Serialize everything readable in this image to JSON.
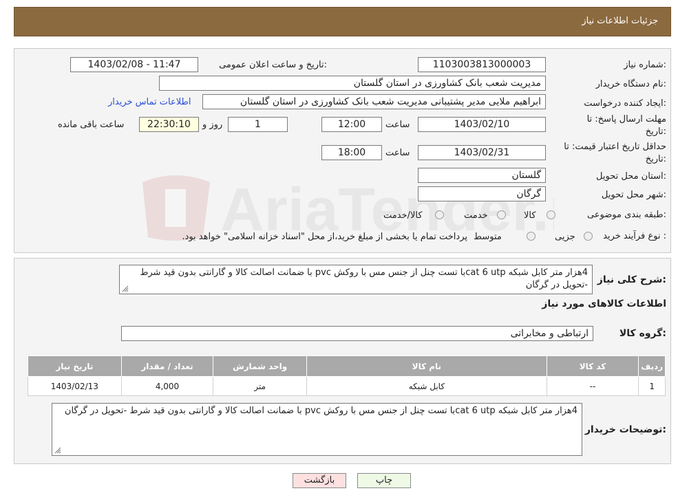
{
  "header": {
    "title": "جزئیات اطلاعات نیاز"
  },
  "form": {
    "need_number_label": "شماره نیاز:",
    "need_number": "1103003813000003",
    "announce_label": "تاریخ و ساعت اعلان عمومی:",
    "announce_value": "1403/02/08 - 11:47",
    "buyer_label": "نام دستگاه خریدار:",
    "buyer_value": "مدیریت شعب بانک کشاورزی در استان گلستان",
    "creator_label": "ایجاد کننده درخواست:",
    "creator_value": "ابراهیم ملایی  مدیر پشتیبانی مدیریت شعب بانک کشاورزی در استان گلستان",
    "contact_link": "اطلاعات تماس خریدار",
    "deadline_label_1": "مهلت ارسال پاسخ: تا",
    "deadline_label_2": "تاریخ:",
    "deadline_date": "1403/02/10",
    "time_label": "ساعت",
    "deadline_time": "12:00",
    "days_value": "1",
    "days_label": "روز و",
    "remaining_value": "22:30:10",
    "remaining_label": "ساعت باقی مانده",
    "validity_label_1": "حداقل تاریخ اعتبار قیمت: تا",
    "validity_label_2": "تاریخ:",
    "validity_date": "1403/02/31",
    "validity_time_label": "ساعت",
    "validity_time": "18:00",
    "province_label": "استان محل تحویل:",
    "province_value": "گلستان",
    "city_label": "شهر محل تحویل:",
    "city_value": "گرگان",
    "category_label": "طبقه بندی موضوعی:",
    "category_options": [
      "کالا",
      "خدمت",
      "کالا/خدمت"
    ],
    "process_label": "نوع فرآیند خرید :",
    "process_options": [
      "جزیی",
      "متوسط"
    ],
    "process_note": "پرداخت تمام یا بخشی از مبلغ خرید،از محل \"اسناد خزانه اسلامی\" خواهد بود."
  },
  "details": {
    "desc_label": "شرح کلی نیاز:",
    "desc_value": "4هزار متر کابل شبکه cat 6 utpبا تست چنل از جنس مس با روکش pvc با ضمانت اصالت کالا و گارانتی بدون قید شرط -تحویل در گرگان",
    "items_title": "اطلاعات کالاهای مورد نیاز",
    "group_label": "گروه کالا:",
    "group_value": "ارتباطی و مخابراتی",
    "table_headers": [
      "ردیف",
      "کد کالا",
      "نام کالا",
      "واحد شمارش",
      "تعداد / مقدار",
      "تاریخ نیاز"
    ],
    "table_rows": [
      [
        "1",
        "--",
        "کابل شبکه",
        "متر",
        "4,000",
        "1403/02/13"
      ]
    ],
    "buyer_notes_label": "توضیحات خریدار:",
    "buyer_notes_value": "4هزار متر کابل شبکه cat 6 utpبا تست چنل از جنس مس با روکش pvc با ضمانت اصالت کالا و گارانتی بدون قید شرط -تحویل در گرگان"
  },
  "buttons": {
    "print": "چاپ",
    "back": "بازگشت"
  },
  "watermark": {
    "text": "AriaTender.neT"
  },
  "colors": {
    "header_bg": "#8c6a3f",
    "table_header_bg": "#a9a9a9",
    "back_button_bg": "#fde0e0",
    "print_button_bg": "#eef9e6"
  }
}
